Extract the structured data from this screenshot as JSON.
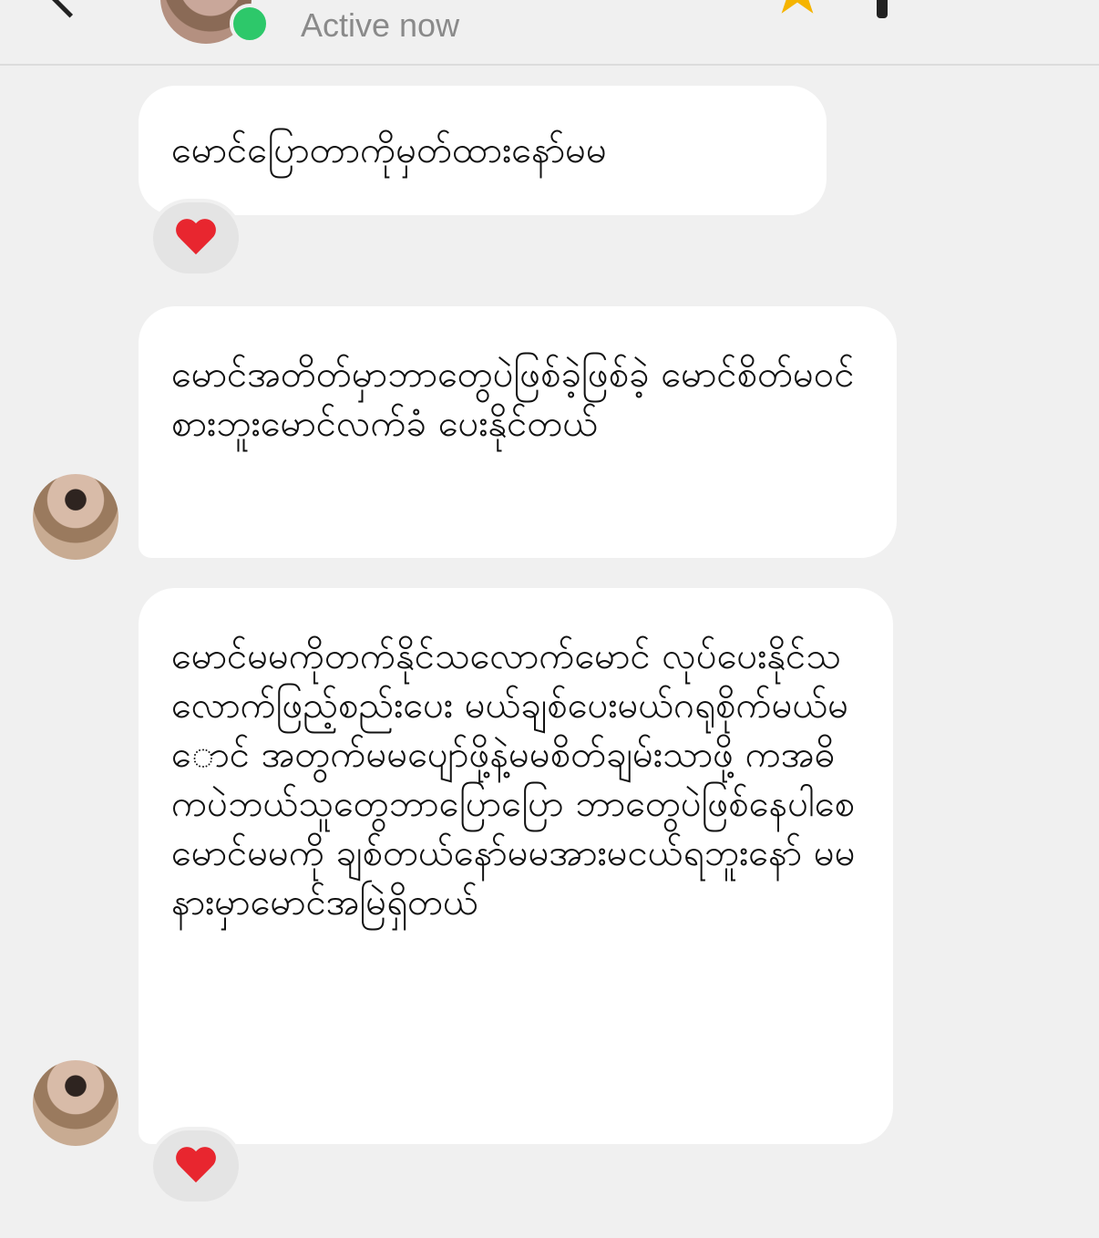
{
  "header": {
    "status": "Active now",
    "back_icon": "chevron-left-icon",
    "favorite_icon": "star-icon",
    "call_icon": "phone-icon"
  },
  "messages": [
    {
      "text": "မောင်ပြောတာကိုမှတ်ထားနော်မမ",
      "reaction": "❤️"
    },
    {
      "text": "မောင်အတိတ်မှာဘာတွေပဲဖြစ်ခဲ့ဖြစ်ခဲ့ မောင်စိတ်မဝင်စားဘူးမောင်လက်ခံ ပေးနိုင်တယ်"
    },
    {
      "text": "မောင်မမကိုတက်နိုင်သလောက်မောင် လုပ်ပေးနိုင်သလောက်ဖြည့်စည်းပေး မယ်ချစ်ပေးမယ်ဂရုစိုက်မယ်မောင် အတွက်မမပျော်ဖို့နဲ့မမစိတ်ချမ်းသာဖို့ ကအဓိကပဲဘယ်သူတွေဘာပြောပြော ဘာတွေပဲဖြစ်နေပါစေမောင်မမကို ချစ်တယ်နော်မမအားမငယ်ရဘူးနော် မမနားမှာမောင်အမြဲရှိတယ်",
      "reaction": "❤️"
    }
  ],
  "colors": {
    "background": "#f0f0f0",
    "bubble": "#ffffff",
    "online": "#2dc86a",
    "star": "#f5b400",
    "heart": "#e8262f"
  }
}
